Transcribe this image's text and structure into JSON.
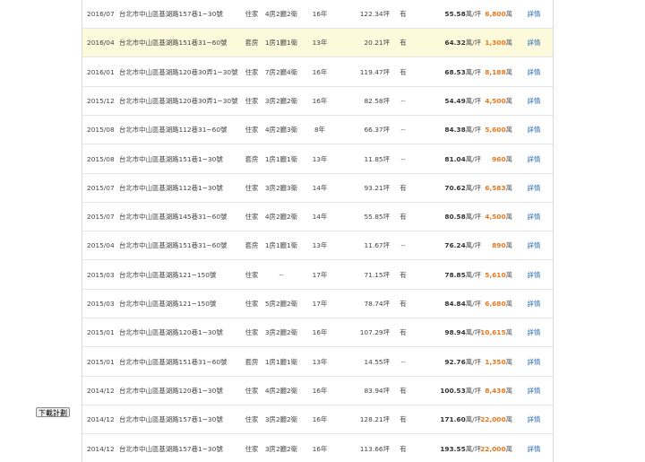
{
  "download_label": "下載計劃",
  "detail_label": "詳情",
  "unit_label": "萬/坪",
  "total_unit": "萬",
  "colors": {
    "total": "#e8771e",
    "link": "#2468b8",
    "highlight": "#fdf9db"
  },
  "rows": [
    {
      "date": "2016/07",
      "address": "台北市中山區基湖路157巷1~30號",
      "type": "住家",
      "layout": "4房2廳2衛",
      "age": "16年",
      "area": "122.34坪",
      "parking": "有",
      "unit_price": "55.58",
      "total": "6,800",
      "highlight": false
    },
    {
      "date": "2016/04",
      "address": "台北市中山區基湖路151巷31~60號",
      "type": "套房",
      "layout": "1房1廳1衛",
      "age": "13年",
      "area": "20.21坪",
      "parking": "有",
      "unit_price": "64.32",
      "total": "1,300",
      "highlight": true
    },
    {
      "date": "2016/01",
      "address": "台北市中山區基湖路120巷30弄1~30號",
      "type": "住家",
      "layout": "7房2廳4衛",
      "age": "16年",
      "area": "119.47坪",
      "parking": "有",
      "unit_price": "68.53",
      "total": "8,188",
      "highlight": false
    },
    {
      "date": "2015/12",
      "address": "台北市中山區基湖路120巷30弄1~30號",
      "type": "住家",
      "layout": "3房2廳2衛",
      "age": "16年",
      "area": "82.58坪",
      "parking": "--",
      "unit_price": "54.49",
      "total": "4,500",
      "highlight": false
    },
    {
      "date": "2015/08",
      "address": "台北市中山區基湖路112巷31~60號",
      "type": "住家",
      "layout": "4房2廳3衛",
      "age": "8年",
      "area": "66.37坪",
      "parking": "--",
      "unit_price": "84.38",
      "total": "5,600",
      "highlight": false
    },
    {
      "date": "2015/08",
      "address": "台北市中山區基湖路151巷1~30號",
      "type": "套房",
      "layout": "1房1廳1衛",
      "age": "13年",
      "area": "11.85坪",
      "parking": "--",
      "unit_price": "81.04",
      "total": "960",
      "highlight": false
    },
    {
      "date": "2015/07",
      "address": "台北市中山區基湖路112巷1~30號",
      "type": "住家",
      "layout": "3房2廳3衛",
      "age": "14年",
      "area": "93.21坪",
      "parking": "有",
      "unit_price": "70.62",
      "total": "6,583",
      "highlight": false
    },
    {
      "date": "2015/07",
      "address": "台北市中山區基湖路145巷31~60號",
      "type": "住家",
      "layout": "4房2廳2衛",
      "age": "14年",
      "area": "55.85坪",
      "parking": "有",
      "unit_price": "80.58",
      "total": "4,500",
      "highlight": false
    },
    {
      "date": "2015/04",
      "address": "台北市中山區基湖路151巷31~60號",
      "type": "套房",
      "layout": "1房1廳1衛",
      "age": "13年",
      "area": "11.67坪",
      "parking": "--",
      "unit_price": "76.24",
      "total": "890",
      "highlight": false
    },
    {
      "date": "2015/03",
      "address": "台北市中山區基湖路121~150號",
      "type": "住家",
      "layout": "--",
      "age": "17年",
      "area": "71.15坪",
      "parking": "有",
      "unit_price": "78.85",
      "total": "5,610",
      "highlight": false
    },
    {
      "date": "2015/03",
      "address": "台北市中山區基湖路121~150號",
      "type": "住家",
      "layout": "5房2廳2衛",
      "age": "17年",
      "area": "78.74坪",
      "parking": "有",
      "unit_price": "84.84",
      "total": "6,680",
      "highlight": false
    },
    {
      "date": "2015/01",
      "address": "台北市中山區基湖路120巷1~30號",
      "type": "住家",
      "layout": "3房2廳2衛",
      "age": "16年",
      "area": "107.29坪",
      "parking": "有",
      "unit_price": "98.94",
      "total": "10,615",
      "highlight": false
    },
    {
      "date": "2015/01",
      "address": "台北市中山區基湖路151巷31~60號",
      "type": "套房",
      "layout": "1房1廳1衛",
      "age": "13年",
      "area": "14.55坪",
      "parking": "--",
      "unit_price": "92.76",
      "total": "1,350",
      "highlight": false
    },
    {
      "date": "2014/12",
      "address": "台北市中山區基湖路120巷1~30號",
      "type": "住家",
      "layout": "4房2廳2衛",
      "age": "16年",
      "area": "83.94坪",
      "parking": "有",
      "unit_price": "100.53",
      "total": "8,438",
      "highlight": false
    },
    {
      "date": "2014/12",
      "address": "台北市中山區基湖路157巷1~30號",
      "type": "住家",
      "layout": "3房2廳2衛",
      "age": "16年",
      "area": "128.21坪",
      "parking": "有",
      "unit_price": "171.60",
      "total": "22,000",
      "highlight": false
    },
    {
      "date": "2014/12",
      "address": "台北市中山區基湖路157巷1~30號",
      "type": "住家",
      "layout": "3房2廳2衛",
      "age": "16年",
      "area": "113.66坪",
      "parking": "有",
      "unit_price": "193.55",
      "total": "22,000",
      "highlight": false
    }
  ]
}
